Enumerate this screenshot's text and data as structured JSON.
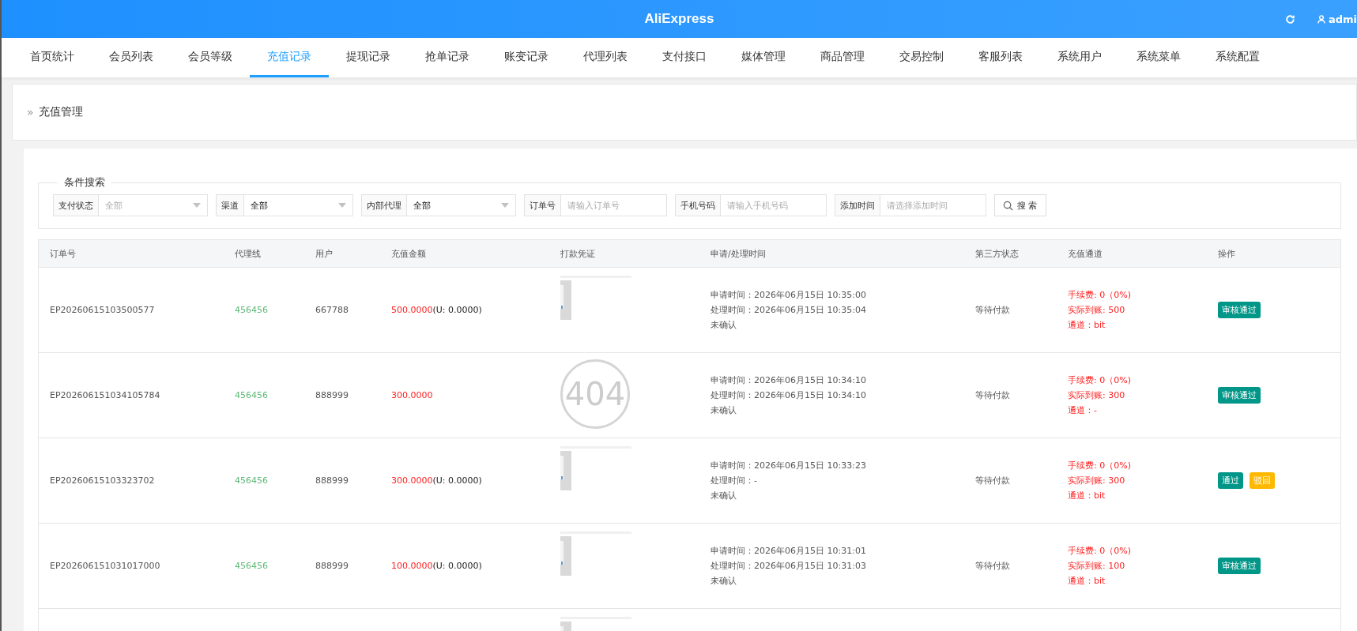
{
  "header": {
    "title": "AliExpress",
    "user": "admi"
  },
  "tabs": [
    {
      "label": "首页统计",
      "selected": false
    },
    {
      "label": "会员列表",
      "selected": false
    },
    {
      "label": "会员等级",
      "selected": false
    },
    {
      "label": "充值记录",
      "selected": true
    },
    {
      "label": "提现记录",
      "selected": false
    },
    {
      "label": "抢单记录",
      "selected": false
    },
    {
      "label": "账变记录",
      "selected": false
    },
    {
      "label": "代理列表",
      "selected": false
    },
    {
      "label": "支付接口",
      "selected": false
    },
    {
      "label": "媒体管理",
      "selected": false
    },
    {
      "label": "商品管理",
      "selected": false
    },
    {
      "label": "交易控制",
      "selected": false
    },
    {
      "label": "客服列表",
      "selected": false
    },
    {
      "label": "系统用户",
      "selected": false
    },
    {
      "label": "系统菜单",
      "selected": false
    },
    {
      "label": "系统配置",
      "selected": false
    }
  ],
  "breadcrumb": {
    "separator": "»",
    "title": "充值管理"
  },
  "search": {
    "legend": "条件搜索",
    "fields": [
      {
        "kind": "select",
        "label": "支付状态",
        "placeholder": "全部"
      },
      {
        "kind": "select",
        "label": "渠道",
        "value": "全部"
      },
      {
        "kind": "select",
        "label": "内部代理",
        "value": "全部"
      },
      {
        "kind": "input",
        "label": "订单号",
        "placeholder": "请输入订单号"
      },
      {
        "kind": "input",
        "label": "手机号码",
        "placeholder": "请输入手机号码"
      },
      {
        "kind": "input",
        "label": "添加时间",
        "placeholder": "请选择添加时间"
      }
    ],
    "button": "搜 索"
  },
  "table": {
    "columns": [
      "订单号",
      "代理线",
      "用户",
      "充值金额",
      "打款凭证",
      "申请/处理时间",
      "第三方状态",
      "充值通道",
      "操作"
    ],
    "rows": [
      {
        "order": "EP20260615103500577",
        "agent": "456456",
        "user": "667788",
        "amount": "500.0000",
        "usdt": "(U: 0.0000)",
        "proof": {
          "kind": "picture"
        },
        "times": [
          "申请时间：2026年06月15日 10:35:00",
          "处理时间：2026年06月15日 10:35:04",
          "未确认"
        ],
        "third_status": "等待付款",
        "channel": [
          "手续费: 0（0%)",
          "实际到账: 500",
          "通道：bit"
        ],
        "actions": [
          {
            "label": "审核通过",
            "kind": "approve"
          }
        ]
      },
      {
        "order": "EP202606151034105784",
        "agent": "456456",
        "user": "888999",
        "amount": "300.0000",
        "proof": {
          "kind": "broken",
          "text": "404"
        },
        "times": [
          "申请时间：2026年06月15日 10:34:10",
          "处理时间：2026年06月15日 10:34:10",
          "未确认"
        ],
        "third_status": "等待付款",
        "channel": [
          "手续费: 0（0%)",
          "实际到账: 300",
          "通道：-"
        ],
        "actions": [
          {
            "label": "审核通过",
            "kind": "approve"
          }
        ]
      },
      {
        "order": "EP20260615103323702",
        "agent": "456456",
        "user": "888999",
        "amount": "300.0000",
        "usdt": "(U: 0.0000)",
        "proof": {
          "kind": "picture"
        },
        "times": [
          "申请时间：2026年06月15日 10:33:23",
          "处理时间：-",
          "未确认"
        ],
        "third_status": "等待付款",
        "channel": [
          "手续费: 0（0%)",
          "实际到账: 300",
          "通道：bit"
        ],
        "actions": [
          {
            "label": "通过",
            "kind": "approve"
          },
          {
            "label": "驳回",
            "kind": "reject"
          }
        ]
      },
      {
        "order": "EP202606151031017000",
        "agent": "456456",
        "user": "888999",
        "amount": "100.0000",
        "usdt": "(U: 0.0000)",
        "proof": {
          "kind": "picture"
        },
        "times": [
          "申请时间：2026年06月15日 10:31:01",
          "处理时间：2026年06月15日 10:31:03",
          "未确认"
        ],
        "third_status": "等待付款",
        "channel": [
          "手续费: 0（0%)",
          "实际到账: 100",
          "通道：bit"
        ],
        "actions": [
          {
            "label": "审核通过",
            "kind": "approve"
          }
        ]
      },
      {
        "proof": {
          "kind": "picture"
        }
      }
    ]
  }
}
